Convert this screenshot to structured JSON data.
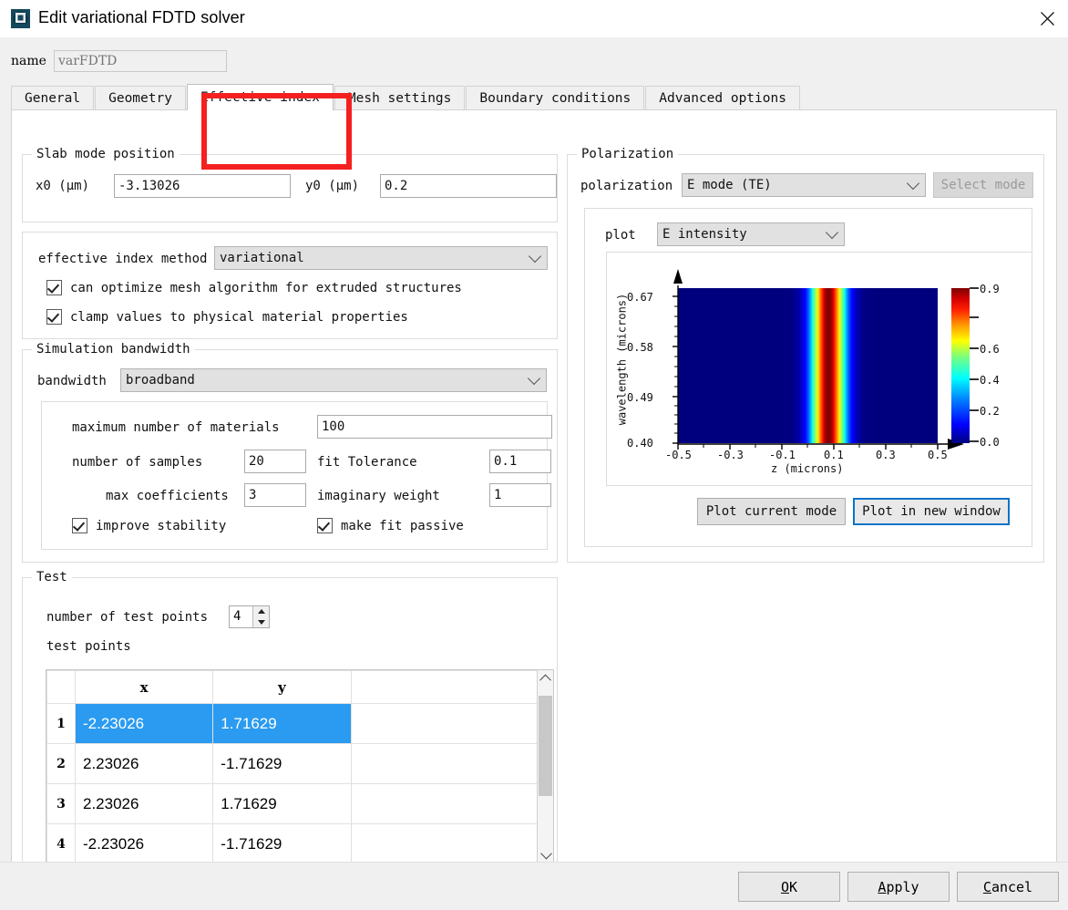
{
  "window": {
    "title": "Edit variational FDTD solver",
    "icon": "app-logo-icon",
    "close_icon": "close-icon"
  },
  "name_field": {
    "label": "name",
    "value": "varFDTD",
    "placeholder": "varFDTD"
  },
  "tabs": [
    {
      "label": "General",
      "active": false
    },
    {
      "label": "Geometry",
      "active": false
    },
    {
      "label": "Effective index",
      "active": true
    },
    {
      "label": "Mesh settings",
      "active": false
    },
    {
      "label": "Boundary conditions",
      "active": false
    },
    {
      "label": "Advanced options",
      "active": false
    }
  ],
  "slab_mode_position": {
    "title": "Slab mode position",
    "x0_label": "x0 (μm)",
    "x0_value": "-3.13026",
    "y0_label": "y0 (μm)",
    "y0_value": "0.2"
  },
  "effective_index": {
    "method_label": "effective index method",
    "method_value": "variational",
    "checkbox_optimize": {
      "label": "can optimize mesh algorithm for extruded structures",
      "checked": true
    },
    "checkbox_clamp": {
      "label": "clamp values to physical material properties",
      "checked": true
    }
  },
  "simulation_bandwidth": {
    "title": "Simulation bandwidth",
    "bandwidth_label": "bandwidth",
    "bandwidth_value": "broadband",
    "max_materials_label": "maximum number of materials",
    "max_materials_value": "100",
    "num_samples_label": "number of samples",
    "num_samples_value": "20",
    "fit_tolerance_label": "fit Tolerance",
    "fit_tolerance_value": "0.1",
    "max_coefficients_label": "max coefficients",
    "max_coefficients_value": "3",
    "imaginary_weight_label": "imaginary weight",
    "imaginary_weight_value": "1",
    "improve_stability": {
      "label": "improve stability",
      "checked": true
    },
    "make_fit_passive": {
      "label": "make fit passive",
      "checked": true
    }
  },
  "test": {
    "title": "Test",
    "num_points_label": "number of test points",
    "num_points_value": "4",
    "points_label": "test points",
    "columns": [
      "",
      "x",
      "y",
      ""
    ],
    "rows": [
      {
        "index": "1",
        "x": "-2.23026",
        "y": "1.71629",
        "selected": true
      },
      {
        "index": "2",
        "x": "2.23026",
        "y": "-1.71629",
        "selected": false
      },
      {
        "index": "3",
        "x": "2.23026",
        "y": "1.71629",
        "selected": false
      },
      {
        "index": "4",
        "x": "-2.23026",
        "y": "-1.71629",
        "selected": false
      }
    ]
  },
  "polarization": {
    "title": "Polarization",
    "label": "polarization",
    "value": "E mode (TE)",
    "select_mode_button": "Select mode",
    "plot_label": "plot",
    "plot_value": "E intensity",
    "plot_current_button": "Plot current mode",
    "plot_new_window_button": "Plot in new window"
  },
  "chart_data": {
    "type": "heatmap",
    "title": "",
    "xlabel": "z (microns)",
    "ylabel": "wavelength (microns)",
    "xticks": [
      "-0.5",
      "-0.3",
      "-0.1",
      "0.1",
      "0.3",
      "0.5"
    ],
    "yticks": [
      "0.40",
      "0.49",
      "0.58",
      "0.67"
    ],
    "xlim": [
      -0.5,
      0.5
    ],
    "ylim": [
      0.4,
      0.7
    ],
    "colorbar": {
      "ticks": [
        "0.0",
        "0.2",
        "0.4",
        "0.6",
        "0.9"
      ],
      "min": 0.0,
      "max": 1.0,
      "colormap": "jet"
    },
    "description": "E intensity profile peaked near z = 0.08 microns, constant across wavelength",
    "peak_z": 0.08,
    "profile_half_width_z": 0.18,
    "grid": false,
    "legend_position": "right"
  },
  "footer": {
    "ok": "OK",
    "ok_mnemonic": "O",
    "apply": "Apply",
    "apply_mnemonic": "A",
    "cancel": "Cancel",
    "cancel_mnemonic": "C"
  },
  "annotation": {
    "color": "#f42020",
    "target": "Effective index tab"
  }
}
